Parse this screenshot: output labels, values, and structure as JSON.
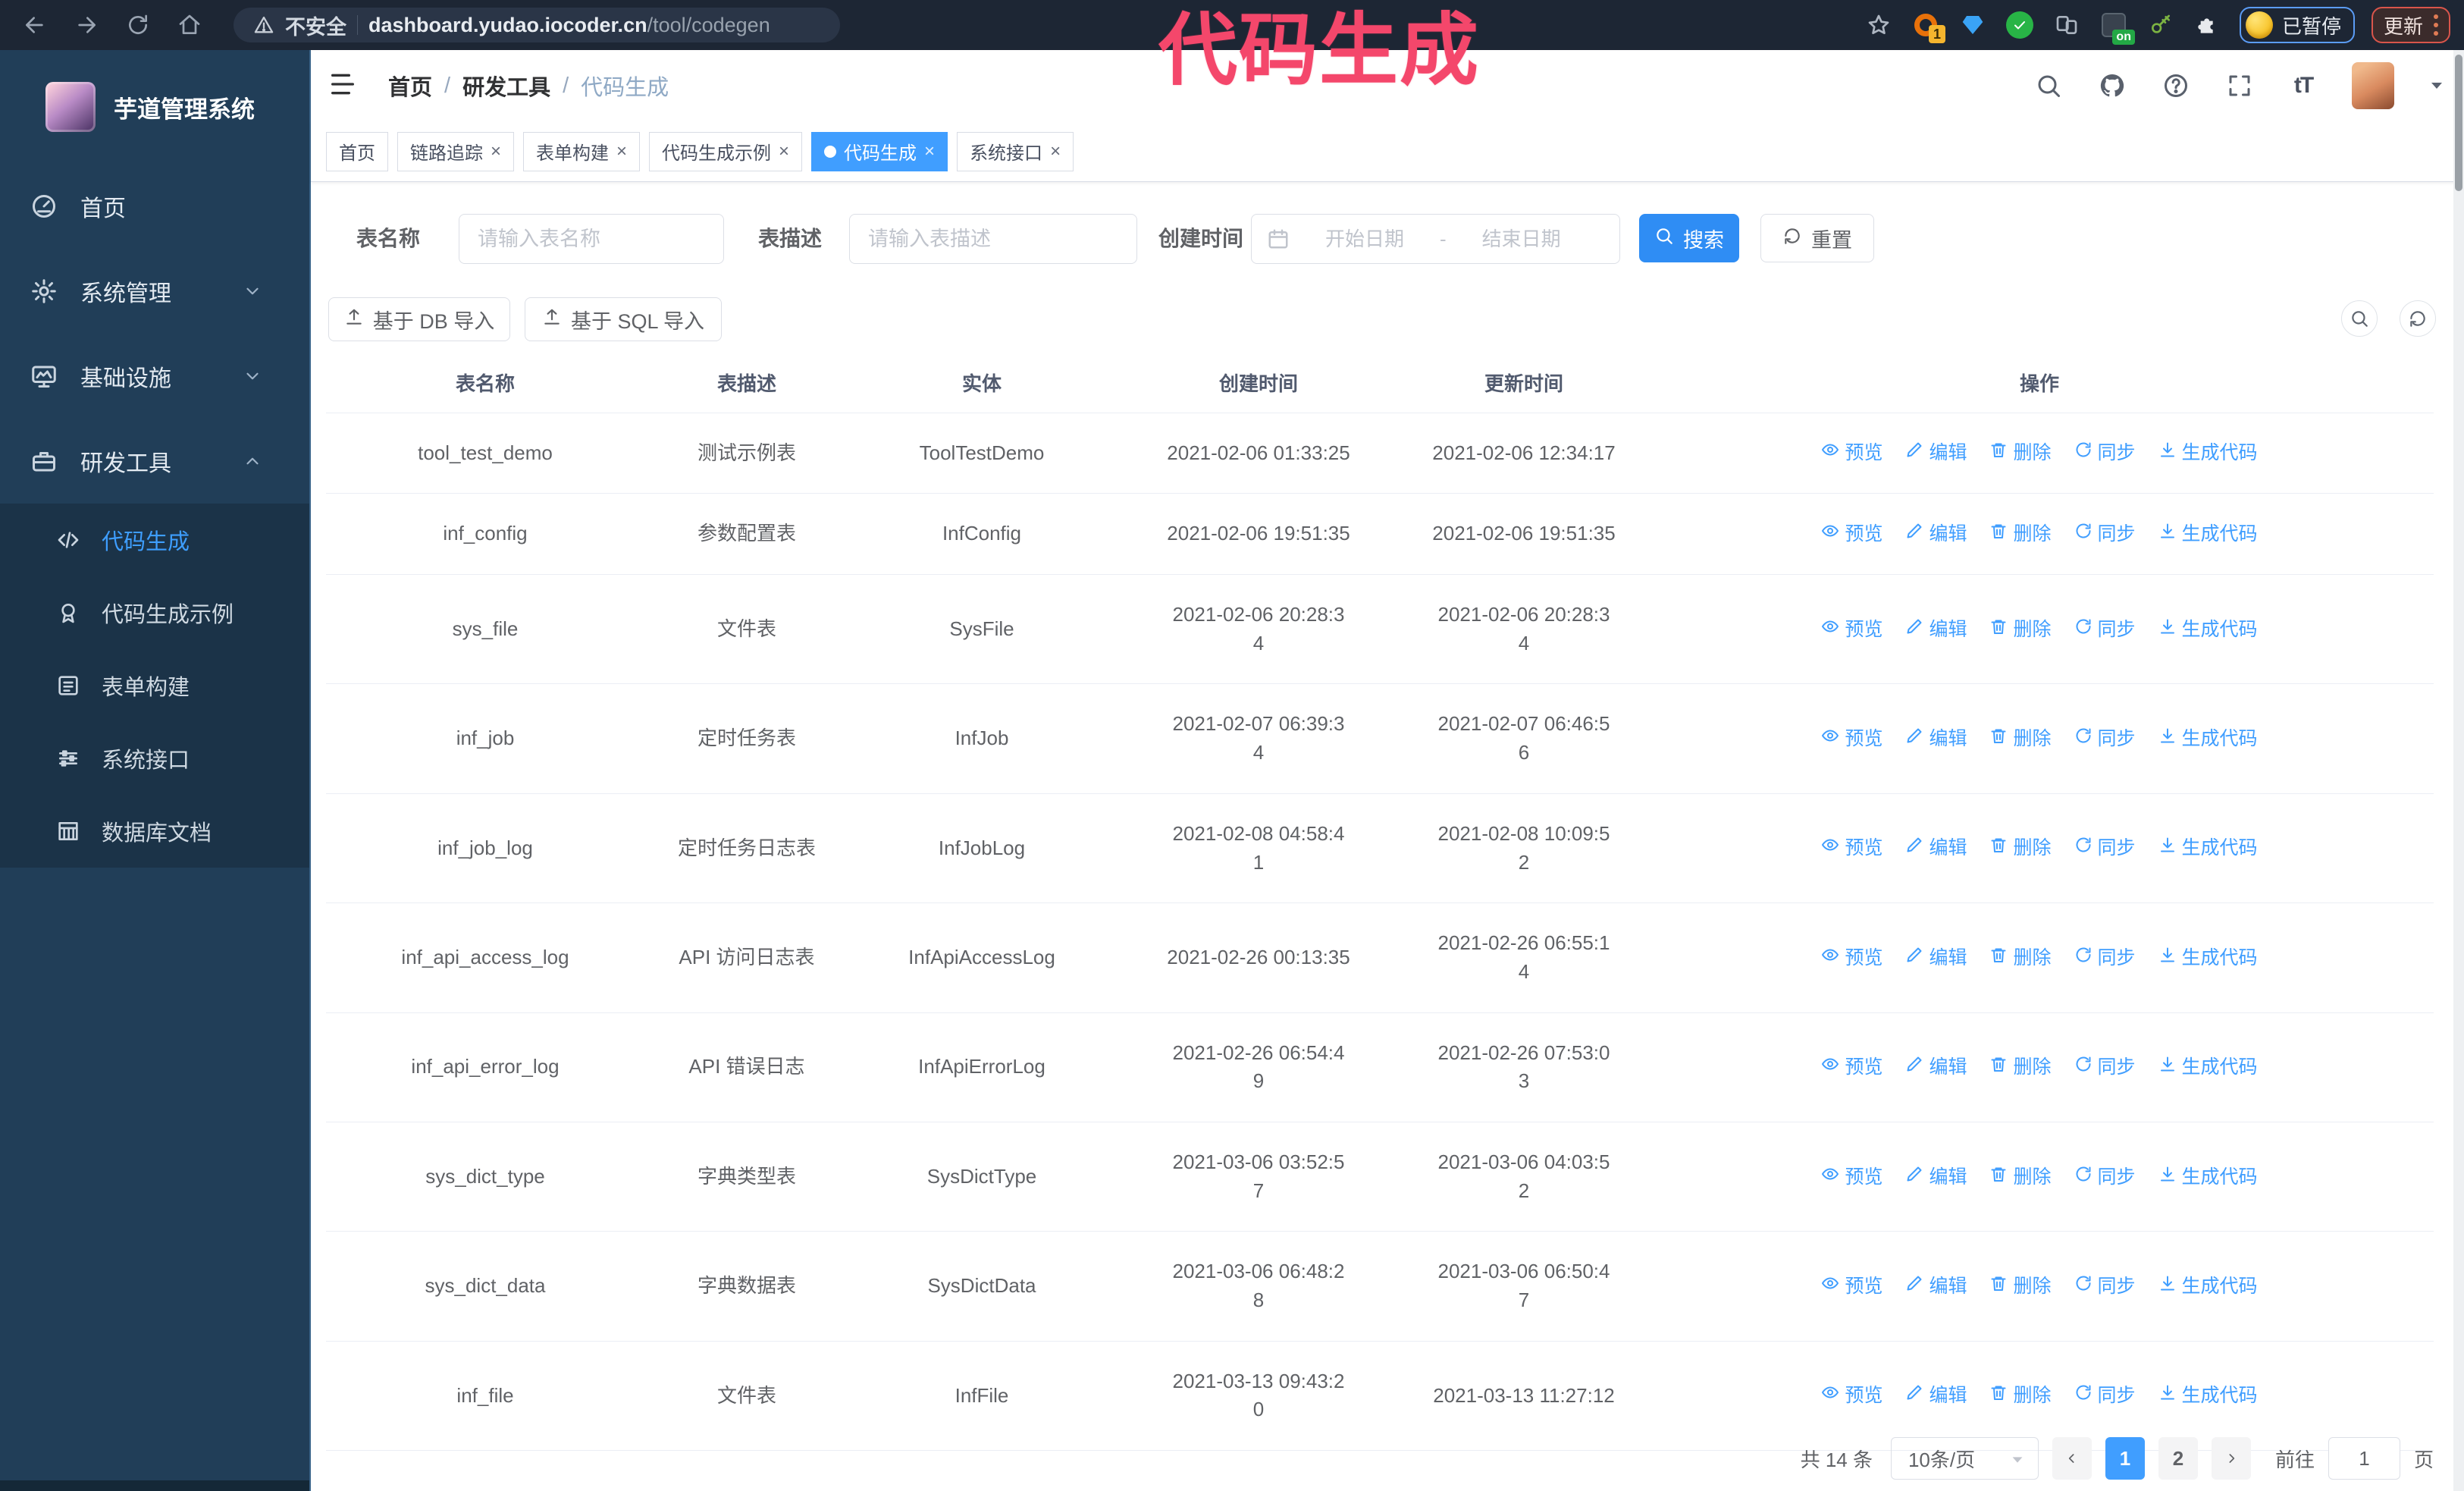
{
  "annotation": {
    "text": "代码生成",
    "color": "#f4476b"
  },
  "colors": {
    "accent": "#409eff",
    "sidebar": "#213e58",
    "submenu": "#1b3348",
    "chrome": "#1d2634",
    "annotation": "#f4476b"
  },
  "browser": {
    "security_label": "不安全",
    "url_domain": "dashboard.yudao.iocoder.cn",
    "url_path": "/tool/codegen",
    "extension_badge": "1",
    "extension_on_badge": "on",
    "profile_chip_label": "已暂停",
    "update_button_label": "更新"
  },
  "sidebar": {
    "app_title": "芋道管理系统",
    "items": [
      {
        "id": "home",
        "label": "首页",
        "icon": "dashboard",
        "chevron": ""
      },
      {
        "id": "system-management",
        "label": "系统管理",
        "icon": "gear",
        "chevron": "down"
      },
      {
        "id": "infrastructure",
        "label": "基础设施",
        "icon": "monitor",
        "chevron": "down"
      },
      {
        "id": "dev-tools",
        "label": "研发工具",
        "icon": "briefcase",
        "chevron": "up"
      }
    ],
    "submenu": [
      {
        "id": "code-generation",
        "label": "代码生成",
        "icon": "code",
        "active": true
      },
      {
        "id": "code-generation-example",
        "label": "代码生成示例",
        "icon": "badge",
        "active": false
      },
      {
        "id": "form-builder",
        "label": "表单构建",
        "icon": "form",
        "active": false
      },
      {
        "id": "system-api",
        "label": "系统接口",
        "icon": "sliders",
        "active": false
      },
      {
        "id": "database-doc",
        "label": "数据库文档",
        "icon": "dbgrid",
        "active": false
      }
    ]
  },
  "header": {
    "breadcrumb": [
      "首页",
      "研发工具",
      "代码生成"
    ],
    "breadcrumb_separator": "/",
    "fontsize_icon_text": "tT"
  },
  "tabs": [
    {
      "label": "首页",
      "closable": false,
      "active": false
    },
    {
      "label": "链路追踪",
      "closable": true,
      "active": false
    },
    {
      "label": "表单构建",
      "closable": true,
      "active": false
    },
    {
      "label": "代码生成示例",
      "closable": true,
      "active": false
    },
    {
      "label": "代码生成",
      "closable": true,
      "active": true
    },
    {
      "label": "系统接口",
      "closable": true,
      "active": false
    }
  ],
  "filters": {
    "table_name_label": "表名称",
    "table_name_placeholder": "请输入表名称",
    "table_desc_label": "表描述",
    "table_desc_placeholder": "请输入表描述",
    "create_time_label": "创建时间",
    "date_start_placeholder": "开始日期",
    "date_separator": "-",
    "date_end_placeholder": "结束日期",
    "search_label": "搜索",
    "reset_label": "重置"
  },
  "toolbar": {
    "import_db_label": "基于 DB 导入",
    "import_sql_label": "基于 SQL 导入"
  },
  "table": {
    "columns": [
      "表名称",
      "表描述",
      "实体",
      "创建时间",
      "更新时间",
      "操作"
    ],
    "actions": [
      {
        "id": "preview",
        "label": "预览",
        "icon": "eye"
      },
      {
        "id": "edit",
        "label": "编辑",
        "icon": "edit"
      },
      {
        "id": "delete",
        "label": "删除",
        "icon": "trash"
      },
      {
        "id": "sync",
        "label": "同步",
        "icon": "sync"
      },
      {
        "id": "generate-code",
        "label": "生成代码",
        "icon": "download"
      }
    ],
    "rows": [
      {
        "name": "tool_test_demo",
        "desc": "测试示例表",
        "entity": "ToolTestDemo",
        "created": "2021-02-06 01:33:25",
        "updated": "2021-02-06 12:34:17"
      },
      {
        "name": "inf_config",
        "desc": "参数配置表",
        "entity": "InfConfig",
        "created": "2021-02-06 19:51:35",
        "updated": "2021-02-06 19:51:35"
      },
      {
        "name": "sys_file",
        "desc": "文件表",
        "entity": "SysFile",
        "created": "2021-02-06 20:28:3\n4",
        "updated": "2021-02-06 20:28:3\n4"
      },
      {
        "name": "inf_job",
        "desc": "定时任务表",
        "entity": "InfJob",
        "created": "2021-02-07 06:39:3\n4",
        "updated": "2021-02-07 06:46:5\n6"
      },
      {
        "name": "inf_job_log",
        "desc": "定时任务日志表",
        "entity": "InfJobLog",
        "created": "2021-02-08 04:58:4\n1",
        "updated": "2021-02-08 10:09:5\n2"
      },
      {
        "name": "inf_api_access_log",
        "desc": "API 访问日志表",
        "entity": "InfApiAccessLog",
        "created": "2021-02-26 00:13:35",
        "updated": "2021-02-26 06:55:1\n4"
      },
      {
        "name": "inf_api_error_log",
        "desc": "API 错误日志",
        "entity": "InfApiErrorLog",
        "created": "2021-02-26 06:54:4\n9",
        "updated": "2021-02-26 07:53:0\n3"
      },
      {
        "name": "sys_dict_type",
        "desc": "字典类型表",
        "entity": "SysDictType",
        "created": "2021-03-06 03:52:5\n7",
        "updated": "2021-03-06 04:03:5\n2"
      },
      {
        "name": "sys_dict_data",
        "desc": "字典数据表",
        "entity": "SysDictData",
        "created": "2021-03-06 06:48:2\n8",
        "updated": "2021-03-06 06:50:4\n7"
      },
      {
        "name": "inf_file",
        "desc": "文件表",
        "entity": "InfFile",
        "created": "2021-03-13 09:43:2\n0",
        "updated": "2021-03-13 11:27:12"
      }
    ]
  },
  "pagination": {
    "total_label": "共 14 条",
    "page_size_label": "10条/页",
    "pages": [
      "1",
      "2"
    ],
    "active_page": "1",
    "goto_label": "前往",
    "goto_value": "1",
    "page_suffix": "页"
  }
}
